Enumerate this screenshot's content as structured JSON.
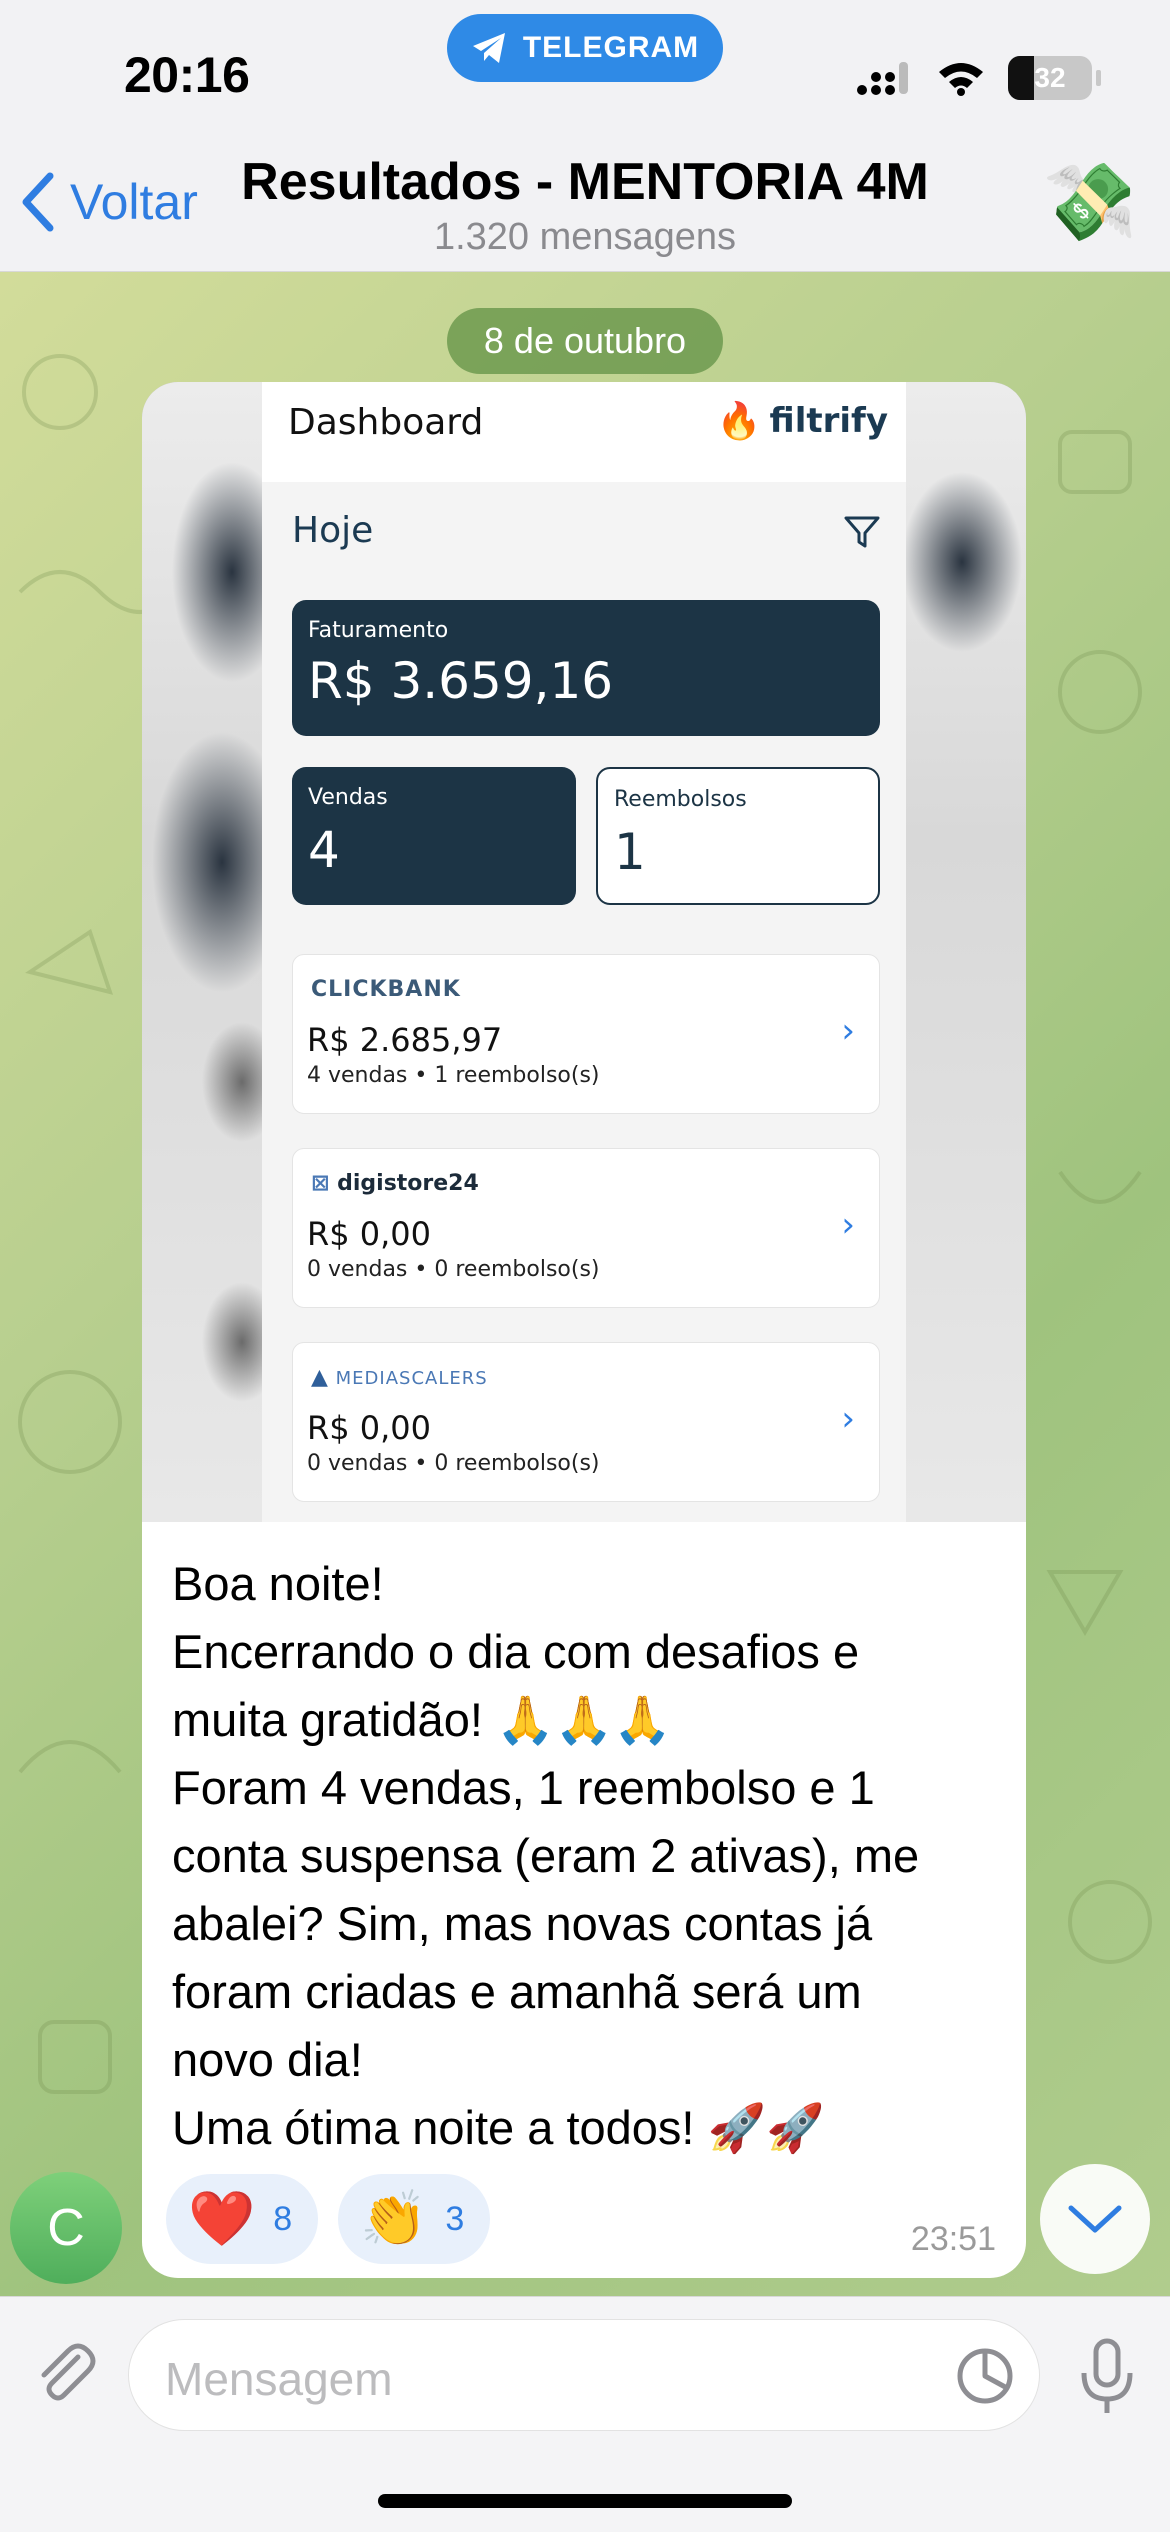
{
  "status_bar": {
    "time": "20:16",
    "app_pill": "TELEGRAM",
    "battery": "32"
  },
  "header": {
    "back_label": "Voltar",
    "title": "Resultados - MENTORIA 4M",
    "subtitle": "1.320 mensagens",
    "avatar_icon": "money-with-wings-icon"
  },
  "chat": {
    "date_label": "8 de outubro",
    "dashboard": {
      "title": "Dashboard",
      "brand": "filtrify",
      "period": "Hoje",
      "revenue_label": "Faturamento",
      "revenue_value": "R$ 3.659,16",
      "sales_label": "Vendas",
      "sales_value": "4",
      "refunds_label": "Reembolsos",
      "refunds_value": "1",
      "platforms": [
        {
          "logo": "CLICKBANK",
          "amount": "R$ 2.685,97",
          "meta": "4 vendas  •  1 reembolso(s)",
          "logo_color": "#3b5a78"
        },
        {
          "logo": "digistore24",
          "amount": "R$ 0,00",
          "meta": "0 vendas  •  0 reembolso(s)",
          "logo_color": "#1c2b3a"
        },
        {
          "logo": "MEDIASCALERS",
          "amount": "R$ 0,00",
          "meta": "0 vendas  •  0 reembolso(s)",
          "logo_color": "#4a78b5"
        }
      ]
    },
    "message": {
      "lines": [
        "Boa noite!",
        "Encerrando o dia com desafios e",
        "muita gratidão! 🙏🙏🙏",
        "Foram 4 vendas, 1 reembolso e 1",
        "conta suspensa (eram 2 ativas), me",
        "abalei? Sim, mas novas contas já",
        "foram criadas e amanhã será um",
        "novo dia!",
        "Uma ótima noite a todos! 🚀🚀"
      ],
      "time": "23:51",
      "reactions": [
        {
          "emoji": "❤️",
          "count": "8"
        },
        {
          "emoji": "👏",
          "count": "3"
        }
      ]
    },
    "sender_initial": "C"
  },
  "input": {
    "placeholder": "Mensagem"
  },
  "colors": {
    "accent": "#2f7de1",
    "telegram_pill": "#2f8ae6",
    "card_dark": "#1c3445"
  }
}
